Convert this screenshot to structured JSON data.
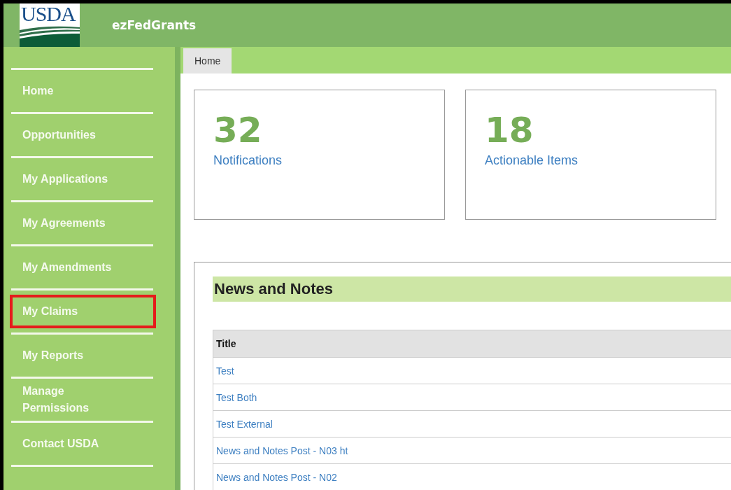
{
  "header": {
    "logo_text": "USDA",
    "app_name": "ezFedGrants"
  },
  "sidebar": {
    "items": [
      {
        "label": "Home",
        "highlighted": false
      },
      {
        "label": "Opportunities",
        "highlighted": false
      },
      {
        "label": "My Applications",
        "highlighted": false
      },
      {
        "label": "My Agreements",
        "highlighted": false
      },
      {
        "label": "My Amendments",
        "highlighted": false
      },
      {
        "label": "My Claims",
        "highlighted": true
      },
      {
        "label": "My Reports",
        "highlighted": false
      },
      {
        "label": "Manage Permissions",
        "highlighted": false
      },
      {
        "label": "Contact USDA",
        "highlighted": false
      }
    ]
  },
  "tabs": [
    {
      "label": "Home",
      "selected": true
    }
  ],
  "stats": [
    {
      "count": "32",
      "label": "Notifications"
    },
    {
      "count": "18",
      "label": "Actionable Items"
    }
  ],
  "news": {
    "title": "News and Notes",
    "columns": [
      "Title"
    ],
    "rows": [
      "Test",
      "Test Both",
      "Test External",
      "News and Notes Post - N03 ht",
      "News and Notes Post - N02"
    ]
  }
}
